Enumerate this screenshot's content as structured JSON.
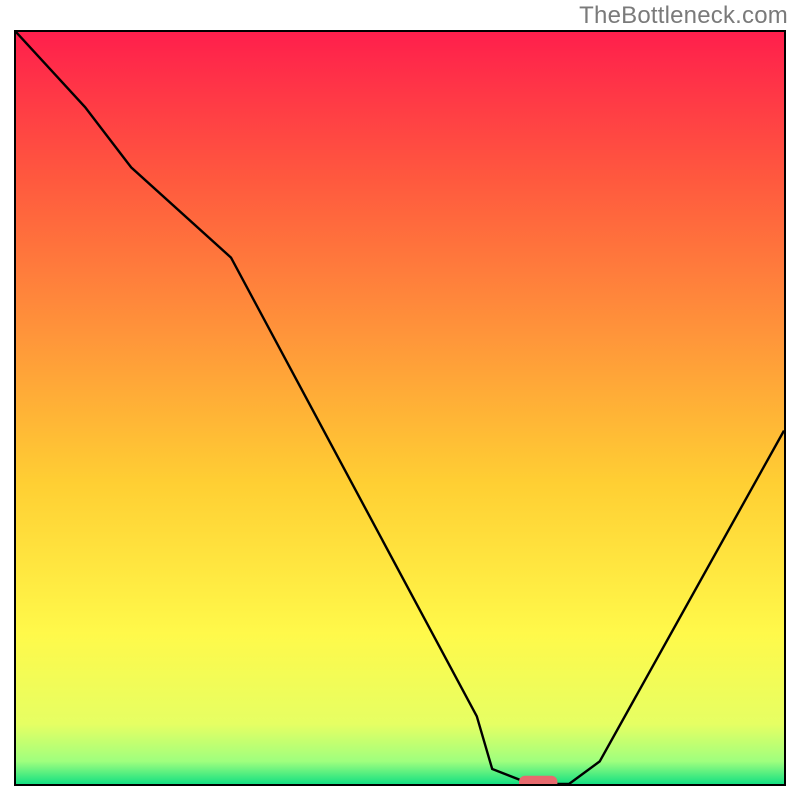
{
  "watermark": "TheBottleneck.com",
  "chart_data": {
    "type": "line",
    "title": "",
    "xlabel": "",
    "ylabel": "",
    "xlim": [
      0,
      100
    ],
    "ylim": [
      0,
      100
    ],
    "background_gradient": {
      "stops": [
        {
          "pct": 0.0,
          "color": "#ff1f4c"
        },
        {
          "pct": 0.2,
          "color": "#ff5a3e"
        },
        {
          "pct": 0.4,
          "color": "#ff943a"
        },
        {
          "pct": 0.6,
          "color": "#ffcf33"
        },
        {
          "pct": 0.8,
          "color": "#fff94a"
        },
        {
          "pct": 0.92,
          "color": "#e6ff63"
        },
        {
          "pct": 0.97,
          "color": "#9fff7e"
        },
        {
          "pct": 1.0,
          "color": "#14e082"
        }
      ]
    },
    "series": [
      {
        "name": "bottleneck-curve",
        "x": [
          0,
          9,
          15,
          28,
          60,
          62,
          67,
          72,
          76,
          100
        ],
        "y": [
          100,
          90,
          82,
          70,
          9,
          2,
          0,
          0,
          3,
          47
        ]
      }
    ],
    "marker": {
      "name": "indicator-pill",
      "x": 68,
      "y": 0,
      "color": "#e76a6e",
      "width": 5,
      "height": 2.2
    }
  }
}
